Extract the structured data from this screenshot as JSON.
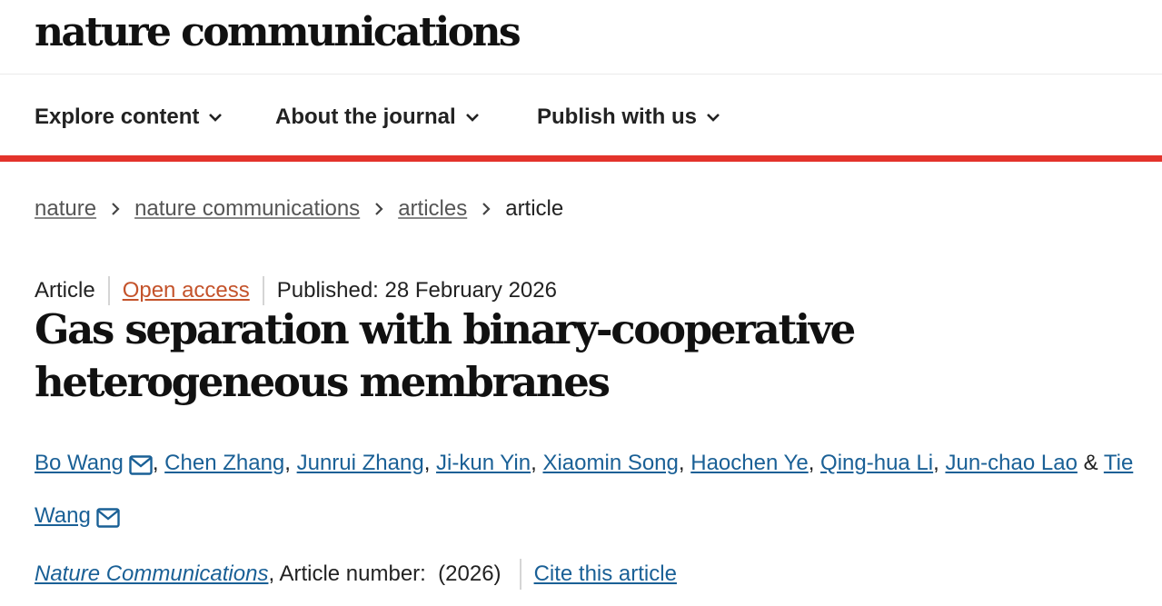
{
  "site": {
    "logo": "nature communications"
  },
  "nav": [
    {
      "label": "Explore content"
    },
    {
      "label": "About the journal"
    },
    {
      "label": "Publish with us"
    }
  ],
  "breadcrumb": [
    {
      "label": "nature"
    },
    {
      "label": "nature communications"
    },
    {
      "label": "articles"
    },
    {
      "label": "article"
    }
  ],
  "article": {
    "type": "Article",
    "access": "Open access",
    "published": "Published: 28 February 2026",
    "title": "Gas separation with binary-cooperative heterogeneous membranes",
    "authors": [
      {
        "name": "Bo Wang",
        "corresponding": true
      },
      {
        "name": "Chen Zhang",
        "corresponding": false
      },
      {
        "name": "Junrui Zhang",
        "corresponding": false
      },
      {
        "name": "Ji-kun Yin",
        "corresponding": false
      },
      {
        "name": "Xiaomin Song",
        "corresponding": false
      },
      {
        "name": "Haochen Ye",
        "corresponding": false
      },
      {
        "name": "Qing-hua Li",
        "corresponding": false
      },
      {
        "name": "Jun-chao Lao",
        "corresponding": false
      },
      {
        "name": "Tie Wang",
        "corresponding": true
      }
    ],
    "journal": "Nature Communications",
    "article_number_label": ", Article number:  (2026)",
    "cite_label": "Cite this article"
  },
  "colors": {
    "accent_red": "#e3332b",
    "link_blue": "#1a6096",
    "open_access_orange": "#c4532b"
  }
}
